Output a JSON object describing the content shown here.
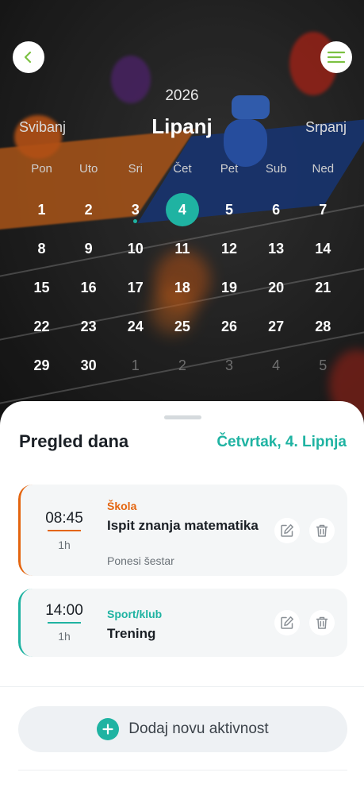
{
  "header": {
    "year": "2026",
    "prev_month": "Svibanj",
    "current_month": "Lipanj",
    "next_month": "Srpanj"
  },
  "weekdays": [
    "Pon",
    "Uto",
    "Sri",
    "Čet",
    "Pet",
    "Sub",
    "Ned"
  ],
  "calendar": {
    "weeks": [
      [
        {
          "d": "1"
        },
        {
          "d": "2"
        },
        {
          "d": "3",
          "event": true
        },
        {
          "d": "4",
          "selected": true
        },
        {
          "d": "5"
        },
        {
          "d": "6"
        },
        {
          "d": "7"
        }
      ],
      [
        {
          "d": "8"
        },
        {
          "d": "9"
        },
        {
          "d": "10"
        },
        {
          "d": "11"
        },
        {
          "d": "12"
        },
        {
          "d": "13"
        },
        {
          "d": "14"
        }
      ],
      [
        {
          "d": "15"
        },
        {
          "d": "16"
        },
        {
          "d": "17"
        },
        {
          "d": "18"
        },
        {
          "d": "19"
        },
        {
          "d": "20"
        },
        {
          "d": "21"
        }
      ],
      [
        {
          "d": "22"
        },
        {
          "d": "23"
        },
        {
          "d": "24"
        },
        {
          "d": "25"
        },
        {
          "d": "26"
        },
        {
          "d": "27"
        },
        {
          "d": "28"
        }
      ],
      [
        {
          "d": "29"
        },
        {
          "d": "30"
        },
        {
          "d": "1",
          "muted": true
        },
        {
          "d": "2",
          "muted": true
        },
        {
          "d": "3",
          "muted": true
        },
        {
          "d": "4",
          "muted": true
        },
        {
          "d": "5",
          "muted": true
        }
      ]
    ]
  },
  "sheet": {
    "title": "Pregled dana",
    "date": "Četvrtak, 4. Lipnja"
  },
  "activities": [
    {
      "time": "08:45",
      "duration": "1h",
      "category": "Škola",
      "title": "Ispit znanja matematika",
      "note": "Ponesi šestar",
      "color": "#e4650f"
    },
    {
      "time": "14:00",
      "duration": "1h",
      "category": "Sport/klub",
      "title": "Trening",
      "note": "",
      "color": "#1fb3a2"
    }
  ],
  "add_button": {
    "label": "Dodaj novu aktivnost"
  },
  "colors": {
    "accent": "#1fb3a2",
    "school": "#e4650f"
  }
}
